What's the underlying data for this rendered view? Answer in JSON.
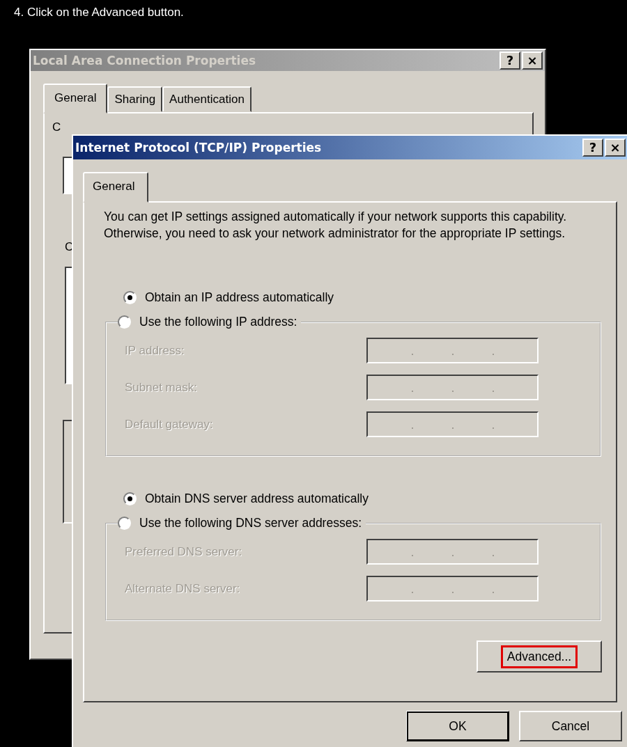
{
  "instruction": "4. Click on the Advanced button.",
  "back_window": {
    "title": "Local Area Connection Properties",
    "active": false,
    "title_buttons": [
      "?",
      "×"
    ],
    "tabs": [
      {
        "label": "General",
        "selected": true
      },
      {
        "label": "Sharing",
        "selected": false
      },
      {
        "label": "Authentication",
        "selected": false
      }
    ],
    "fragments": [
      "C",
      "C"
    ]
  },
  "front_window": {
    "title": "Internet Protocol (TCP/IP) Properties",
    "active": true,
    "title_buttons": [
      "?",
      "×"
    ],
    "tabs": [
      {
        "label": "General",
        "selected": true
      }
    ],
    "description": "You can get IP settings assigned automatically if your network supports this capability. Otherwise, you need to ask your network administrator for the appropriate IP settings.",
    "ip_options": [
      {
        "label": "Obtain an IP address automatically",
        "selected": true
      },
      {
        "label": "Use the following IP address:",
        "selected": false
      }
    ],
    "ip_fields": [
      {
        "label": "IP address:",
        "disabled": true
      },
      {
        "label": "Subnet mask:",
        "disabled": true
      },
      {
        "label": "Default gateway:",
        "disabled": true
      }
    ],
    "dns_options": [
      {
        "label": "Obtain DNS server address automatically",
        "selected": true
      },
      {
        "label": "Use the following DNS server addresses:",
        "selected": false
      }
    ],
    "dns_fields": [
      {
        "label": "Preferred DNS server:",
        "disabled": true
      },
      {
        "label": "Alternate DNS server:",
        "disabled": true
      }
    ],
    "advanced_button": {
      "label": "Advanced...",
      "highlighted": true
    },
    "buttons": [
      {
        "label": "OK",
        "default": true
      },
      {
        "label": "Cancel",
        "default": false
      }
    ]
  }
}
